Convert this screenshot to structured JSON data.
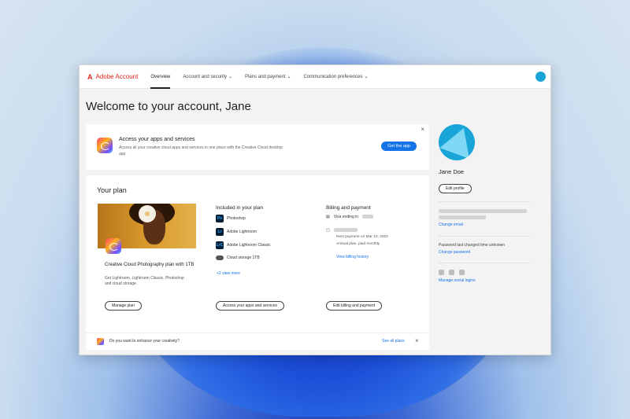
{
  "nav": {
    "brand": "Adobe Account",
    "items": [
      {
        "label": "Overview",
        "active": true,
        "dropdown": false
      },
      {
        "label": "Account and security",
        "active": false,
        "dropdown": true
      },
      {
        "label": "Plans and payment",
        "active": false,
        "dropdown": true
      },
      {
        "label": "Communication preferences",
        "active": false,
        "dropdown": true
      }
    ]
  },
  "page_title": "Welcome to your account, Jane",
  "promo": {
    "title": "Access your apps and services",
    "body": "Access all your creative cloud apps and services in one place with the Creative Cloud desktop app.",
    "button": "Get the app",
    "close": "×"
  },
  "plan": {
    "heading": "Your plan",
    "name": "Creative Cloud Photography plan with 1TB",
    "description": "Get Lightroom, Lightroom Classic, Photoshop and cloud storage.",
    "manage_button": "Manage plan",
    "included_heading": "Included in your plan",
    "included": [
      {
        "icon": "Ps",
        "label": "Photoshop"
      },
      {
        "icon": "Lr",
        "label": "Adobe Lightroom"
      },
      {
        "icon": "LrC",
        "label": "Adobe Lightroom Classic"
      },
      {
        "icon": "cloud",
        "label": "Cloud storage 1TB"
      }
    ],
    "view_more": "+2 view more",
    "access_button": "Access your apps and services",
    "billing_heading": "Billing and payment",
    "card_label": "Visa ending in",
    "last_payment": "Next payment on Mar 10, 2022",
    "billing_cycle": "Annual plan, paid monthly",
    "history_link": "View billing history",
    "edit_button": "Edit billing and payment"
  },
  "footer": {
    "question": "Do you want to enhance your creativity?",
    "link": "See all plans",
    "close": "×"
  },
  "profile": {
    "name": "Jane Doe",
    "edit_button": "Edit profile",
    "change_email": "Change email",
    "password_text": "Password last changed time unknown",
    "change_password": "Change password",
    "manage_social": "Manage social logins"
  },
  "colors": {
    "accent": "#1473e6",
    "brand": "#e2231a",
    "avatar": "#1aa5d9"
  }
}
